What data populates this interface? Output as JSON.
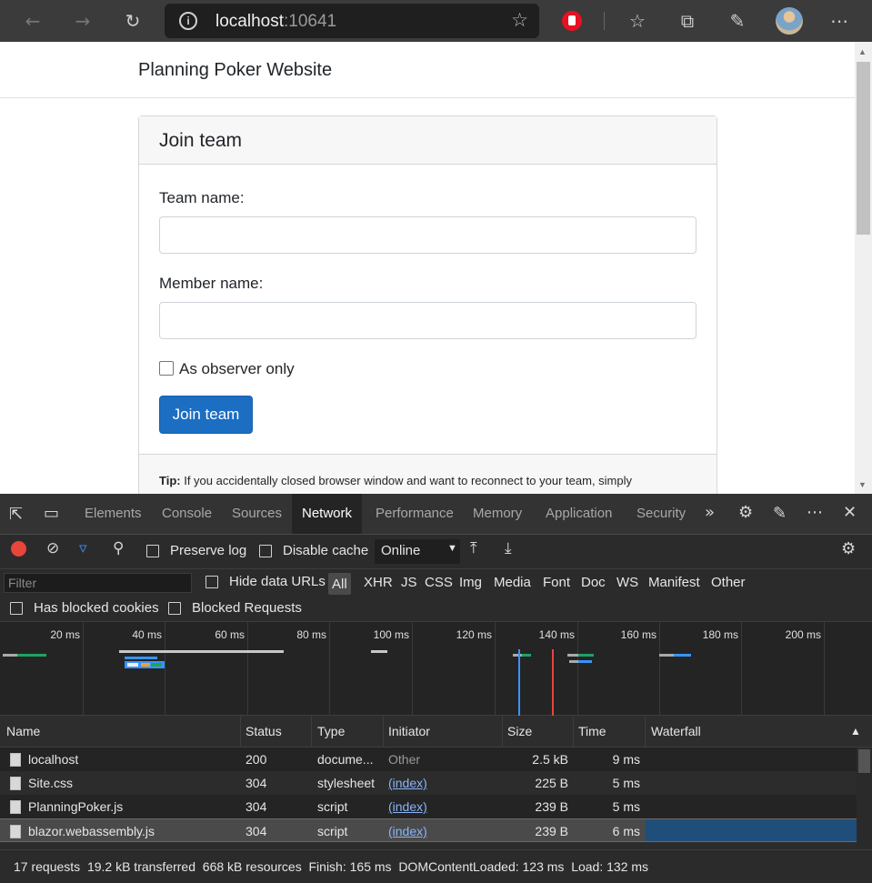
{
  "browser": {
    "url_host": "localhost",
    "url_port": ":10641"
  },
  "page": {
    "site_title": "Planning Poker Website",
    "card_title": "Join team",
    "team_name_label": "Team name:",
    "team_name_value": "",
    "member_name_label": "Member name:",
    "member_name_value": "",
    "observer_label": "As observer only",
    "observer_checked": false,
    "join_button": "Join team",
    "tip_bold": "Tip:",
    "tip_text": " If you accidentally closed browser window and want to reconnect to your team, simply"
  },
  "devtools": {
    "tabs": [
      "Elements",
      "Console",
      "Sources",
      "Network",
      "Performance",
      "Memory",
      "Application",
      "Security"
    ],
    "active_tab": "Network",
    "preserve_log": "Preserve log",
    "disable_cache": "Disable cache",
    "throttle": "Online",
    "filter_placeholder": "Filter",
    "hide_data_urls": "Hide data URLs",
    "type_filters": [
      "All",
      "XHR",
      "JS",
      "CSS",
      "Img",
      "Media",
      "Font",
      "Doc",
      "WS",
      "Manifest",
      "Other"
    ],
    "active_type_filter": "All",
    "has_blocked_cookies": "Has blocked cookies",
    "blocked_requests": "Blocked Requests",
    "timeline_ticks": [
      "20 ms",
      "40 ms",
      "60 ms",
      "80 ms",
      "100 ms",
      "120 ms",
      "140 ms",
      "160 ms",
      "180 ms",
      "200 ms"
    ],
    "columns": [
      "Name",
      "Status",
      "Type",
      "Initiator",
      "Size",
      "Time",
      "Waterfall"
    ],
    "rows": [
      {
        "name": "localhost",
        "status": "200",
        "type": "docume...",
        "initiator": "Other",
        "size": "2.5 kB",
        "time": "9 ms",
        "link": false,
        "selected": false
      },
      {
        "name": "Site.css",
        "status": "304",
        "type": "stylesheet",
        "initiator": "(index)",
        "size": "225 B",
        "time": "5 ms",
        "link": true,
        "selected": false
      },
      {
        "name": "PlanningPoker.js",
        "status": "304",
        "type": "script",
        "initiator": "(index)",
        "size": "239 B",
        "time": "5 ms",
        "link": true,
        "selected": false
      },
      {
        "name": "blazor.webassembly.js",
        "status": "304",
        "type": "script",
        "initiator": "(index)",
        "size": "239 B",
        "time": "6 ms",
        "link": true,
        "selected": true
      }
    ],
    "status_summary": "17 requests  19.2 kB transferred  668 kB resources  Finish: 165 ms  DOMContentLoaded: 123 ms  Load: 132 ms"
  },
  "colors": {
    "record_button": "#e8453c",
    "filter_icon": "#3794ff",
    "primary_button": "#1b6ec2",
    "selected_row": "#1f4e7a",
    "dom_content_loaded_line": "#3794ff",
    "load_line": "#e8453c"
  }
}
